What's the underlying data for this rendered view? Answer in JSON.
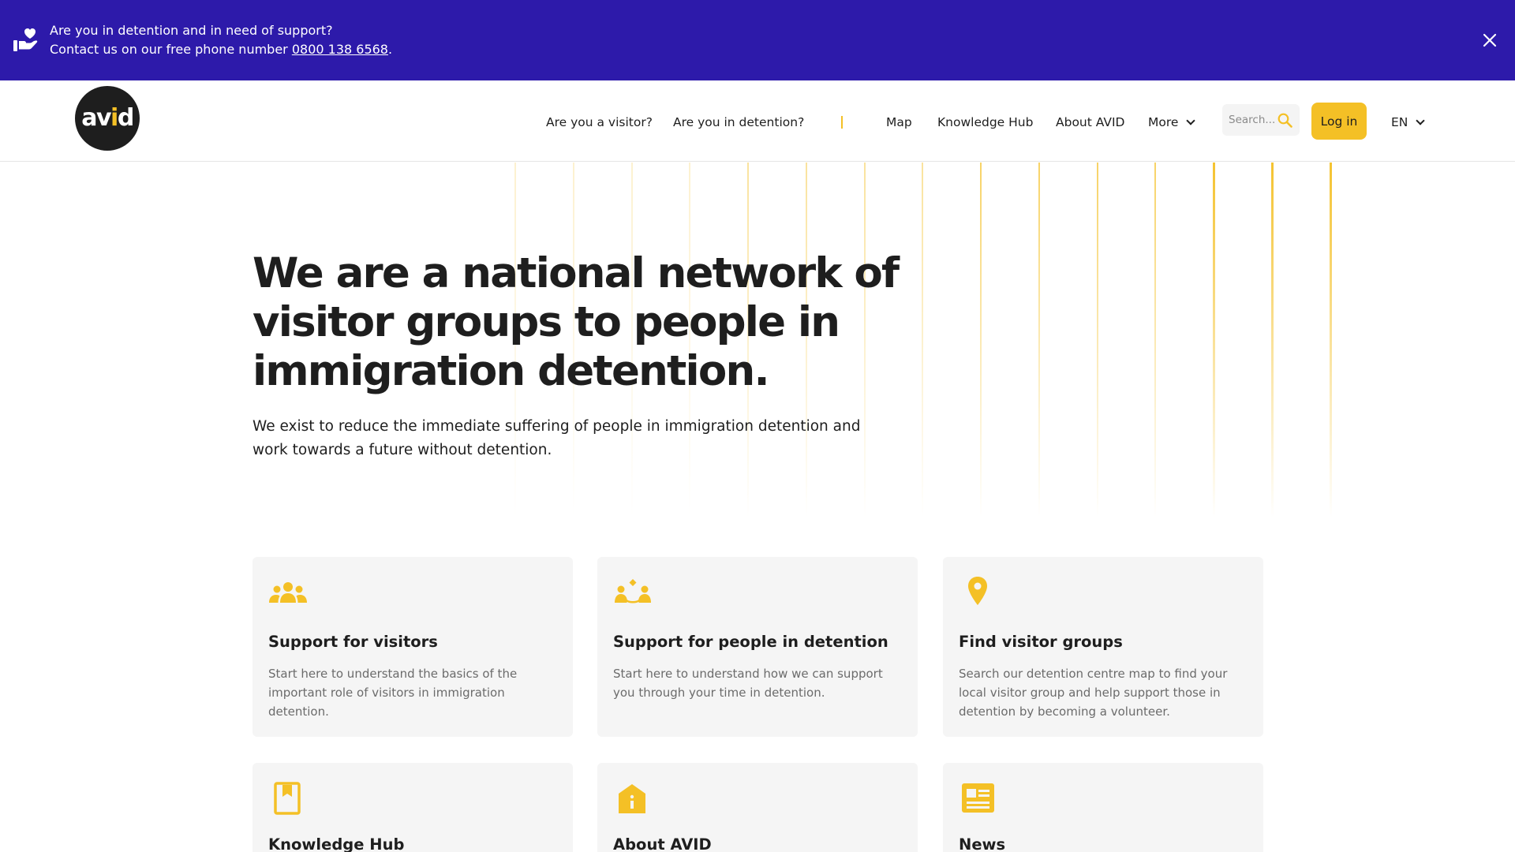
{
  "banner": {
    "line1": "Are you in detention and in need of support?",
    "line2_prefix": "Contact us on our free phone number ",
    "phone": "0800 138 6568",
    "line2_suffix": ".",
    "icon": "heart-in-hand-icon",
    "close_icon": "close-icon",
    "background": "#2d1aaa"
  },
  "header": {
    "logo": {
      "prefix": "av",
      "accent": "i",
      "suffix": "d"
    },
    "nav": {
      "visitor": "Are you a visitor?",
      "detention": "Are you in detention?",
      "map": "Map",
      "knowledge_hub": "Knowledge Hub",
      "about": "About AVID",
      "more": "More"
    },
    "search_placeholder": "Search...",
    "login": "Log in",
    "language": "EN"
  },
  "hero": {
    "title": "We are a national network of visitor groups to people in immigration detention.",
    "subtitle": "We exist to reduce the immediate suffering of people in immigration detention and work towards a future without detention."
  },
  "cards": [
    {
      "icon": "group-of-people-icon",
      "title": "Support for visitors",
      "description": "Start here to understand the basics of the important role of visitors in immigration detention."
    },
    {
      "icon": "people-support-icon",
      "title": "Support for people in detention",
      "description": "Start here to understand how we can support you through your time in detention."
    },
    {
      "icon": "map-pin-icon",
      "title": "Find visitor groups",
      "description": "Search our detention centre map to find your local visitor group and help support those in detention by becoming a volunteer."
    },
    {
      "icon": "bookmark-book-icon",
      "title": "Knowledge Hub",
      "description": ""
    },
    {
      "icon": "info-house-icon",
      "title": "About AVID",
      "description": ""
    },
    {
      "icon": "newspaper-icon",
      "title": "News",
      "description": ""
    }
  ],
  "colors": {
    "accent": "#f4c026",
    "banner": "#2d1aaa",
    "text": "#1e1e1e",
    "card_bg": "#f5f5f5"
  }
}
